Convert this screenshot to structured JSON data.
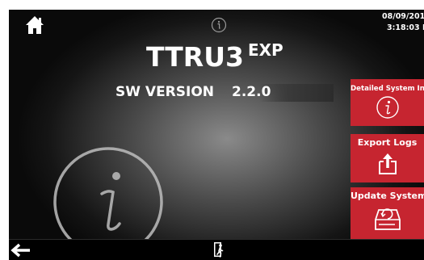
{
  "header": {
    "date": "08/09/201",
    "time": "3:18:03 P",
    "icons": [
      "home-icon",
      "info-icon"
    ]
  },
  "product": {
    "name": "TTRU3",
    "suffix": "EXP"
  },
  "software": {
    "label": "SW VERSION",
    "version": "2.2.0"
  },
  "side_buttons": [
    {
      "label": "Detailed System Info",
      "icon": "info-icon"
    },
    {
      "label": "Export Logs",
      "icon": "export-icon"
    },
    {
      "label": "Update System",
      "icon": "update-drive-icon"
    }
  ],
  "footer": {
    "icons": [
      "back-arrow-icon",
      "exit-icon"
    ]
  },
  "colors": {
    "accent": "#c62530",
    "background": "#000000",
    "text": "#ffffff"
  }
}
